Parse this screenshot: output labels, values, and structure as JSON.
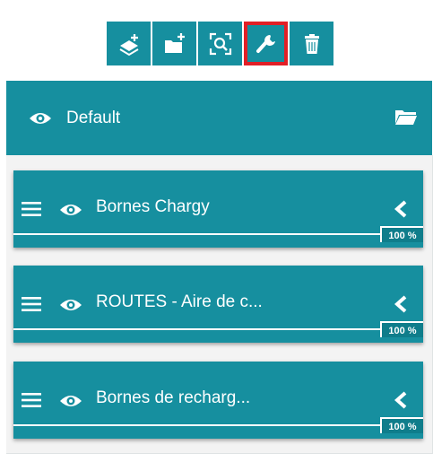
{
  "toolbar": {
    "buttons": [
      {
        "icon": "add-layer-icon"
      },
      {
        "icon": "add-folder-icon"
      },
      {
        "icon": "zoom-extent-icon"
      },
      {
        "icon": "wrench-icon",
        "selected": true
      },
      {
        "icon": "trash-icon"
      }
    ]
  },
  "group": {
    "title": "Default",
    "icon": "folder-open-icon"
  },
  "layers": [
    {
      "name": "Bornes Chargy",
      "opacity": "100 %"
    },
    {
      "name": "ROUTES - Aire de c...",
      "opacity": "100 %"
    },
    {
      "name": "Bornes de recharg...",
      "opacity": "100 %"
    }
  ],
  "colors": {
    "accent": "#168f9f",
    "highlight": "#e21f26"
  }
}
